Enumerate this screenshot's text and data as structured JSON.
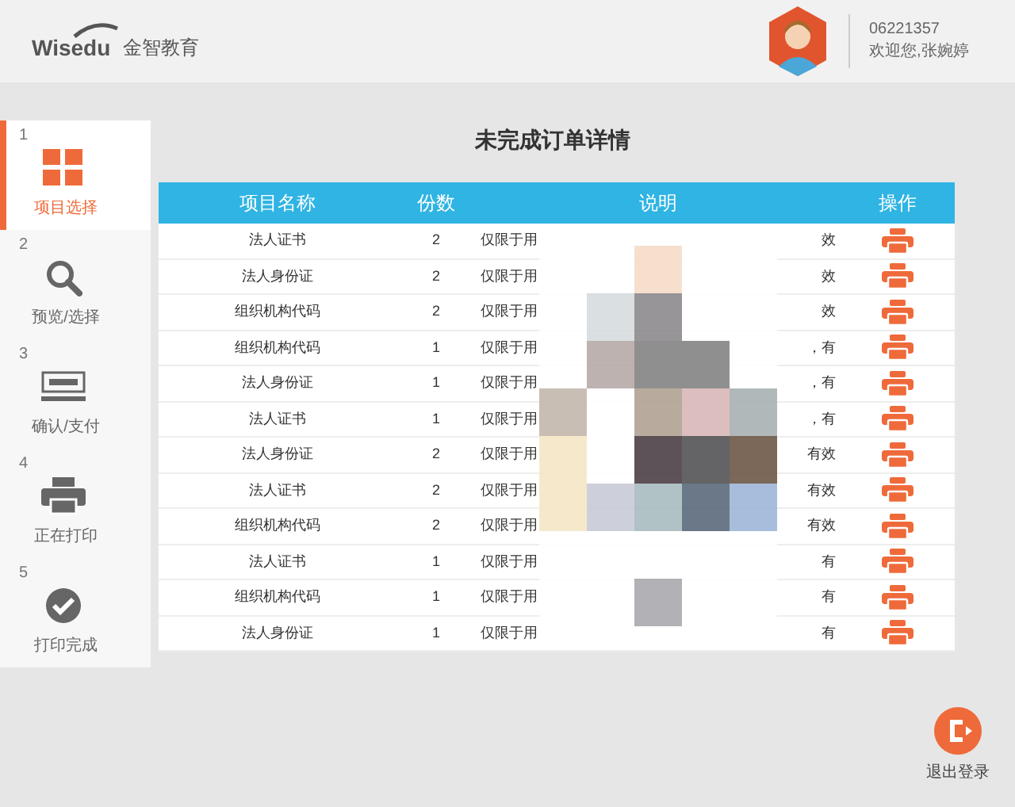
{
  "header": {
    "logo": "Wisedu",
    "brand": "金智教育",
    "user_id": "06221357",
    "greeting": "欢迎您,张婉婷"
  },
  "steps": [
    {
      "number": "1",
      "label": "项目选择",
      "selected": true
    },
    {
      "number": "2",
      "label": "预览/选择",
      "selected": false
    },
    {
      "number": "3",
      "label": "确认/支付",
      "selected": false
    },
    {
      "number": "4",
      "label": "正在打印",
      "selected": false
    },
    {
      "number": "5",
      "label": "打印完成",
      "selected": false
    }
  ],
  "title": "未完成订单详情",
  "table": {
    "columns": [
      "项目名称",
      "份数",
      "说明",
      "操作"
    ],
    "rows": [
      {
        "name": "法人证书",
        "count": "2",
        "note_start": "仅限于用",
        "note_end": "效"
      },
      {
        "name": "法人身份证",
        "count": "2",
        "note_start": "仅限于用",
        "note_end": "效"
      },
      {
        "name": "组织机构代码",
        "count": "2",
        "note_start": "仅限于用",
        "note_end": "效"
      },
      {
        "name": "组织机构代码",
        "count": "1",
        "note_start": "仅限于用",
        "note_end": "，有"
      },
      {
        "name": "法人身份证",
        "count": "1",
        "note_start": "仅限于用",
        "note_end": "，有"
      },
      {
        "name": "法人证书",
        "count": "1",
        "note_start": "仅限于用",
        "note_end": "，有"
      },
      {
        "name": "法人身份证",
        "count": "2",
        "note_start": "仅限于用",
        "note_end": "有效"
      },
      {
        "name": "法人证书",
        "count": "2",
        "note_start": "仅限于用",
        "note_end": "有效"
      },
      {
        "name": "组织机构代码",
        "count": "2",
        "note_start": "仅限于用",
        "note_end": "有效"
      },
      {
        "name": "法人证书",
        "count": "1",
        "note_start": "仅限于用",
        "note_end": "有"
      },
      {
        "name": "组织机构代码",
        "count": "1",
        "note_start": "仅限于用",
        "note_end": "有"
      },
      {
        "name": "法人身份证",
        "count": "1",
        "note_start": "仅限于用",
        "note_end": "有"
      }
    ]
  },
  "logout": "退出登录"
}
